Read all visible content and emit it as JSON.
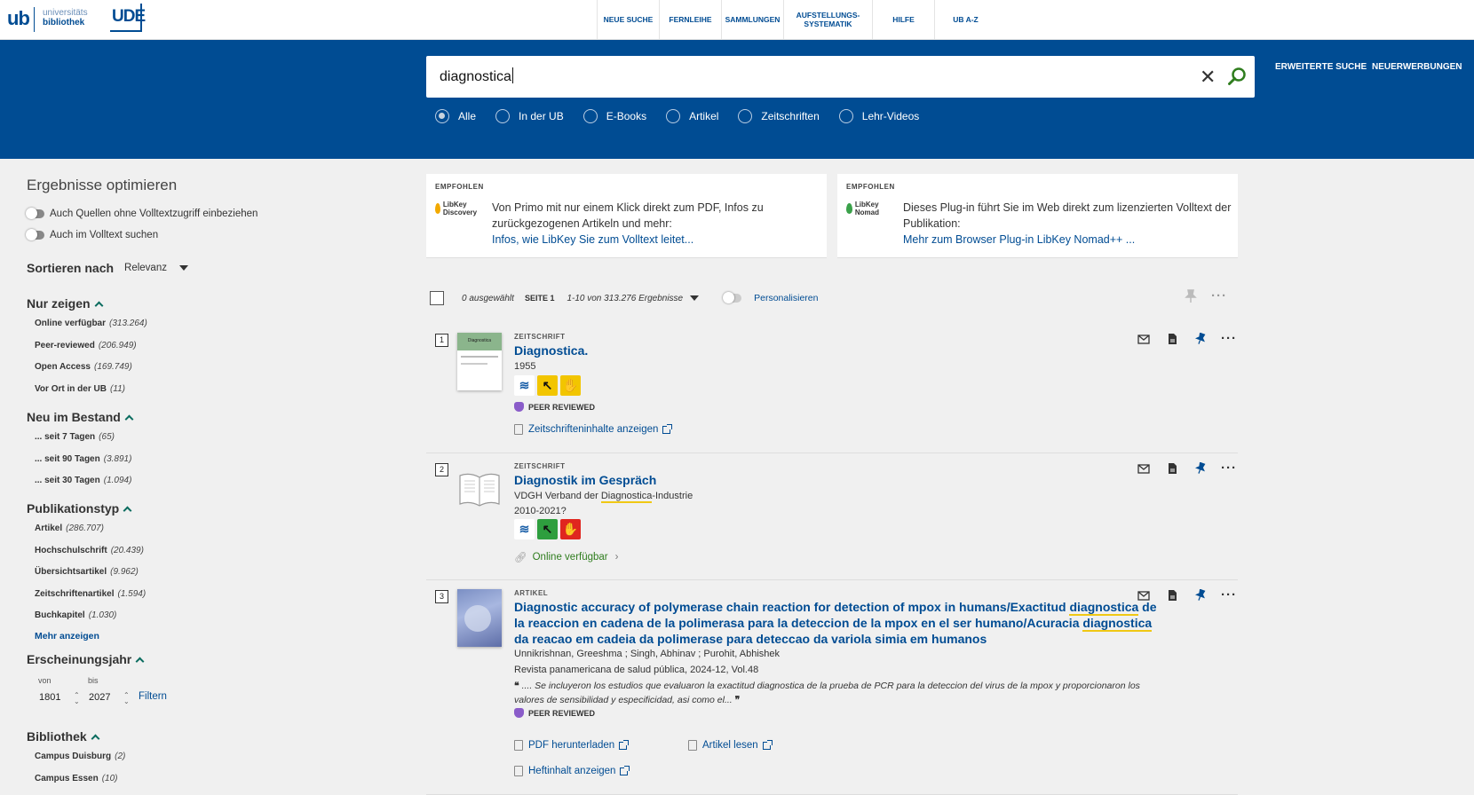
{
  "header": {
    "logo_ub": "ub",
    "logo_line1": "universitäts",
    "logo_line2": "bibliothek",
    "logo_ude": "UDE",
    "nav": [
      {
        "label": "NEUE SUCHE",
        "w": 70
      },
      {
        "label": "FERNLEIHE",
        "w": 70
      },
      {
        "label": "SAMMLUNGEN",
        "w": 70
      },
      {
        "label": "AUFSTELLUNGS-\nSYSTEMATIK",
        "w": 100
      },
      {
        "label": "HILFE",
        "w": 70
      },
      {
        "label": "UB A-Z",
        "w": 70
      }
    ]
  },
  "search": {
    "query": "diagnostica",
    "advanced_label": "ERWEITERTE SUCHE",
    "new_label": "NEUERWERBUNGEN",
    "scopes": [
      "Alle",
      "In der UB",
      "E-Books",
      "Artikel",
      "Zeitschriften",
      "Lehr-Videos"
    ]
  },
  "sidebar": {
    "title": "Ergebnisse optimieren",
    "toggle1": "Auch Quellen ohne Volltextzugriff einbeziehen",
    "toggle2": "Auch im Volltext suchen",
    "sort_label": "Sortieren nach",
    "sort_value": "Relevanz",
    "facets": [
      {
        "title": "Nur zeigen",
        "items": [
          [
            "Online verfügbar",
            "(313.264)"
          ],
          [
            "Peer-reviewed",
            "(206.949)"
          ],
          [
            "Open Access",
            "(169.749)"
          ],
          [
            "Vor Ort in der UB",
            "(11)"
          ]
        ]
      },
      {
        "title": "Neu im Bestand",
        "items": [
          [
            "... seit 7 Tagen",
            "(65)"
          ],
          [
            "... seit 90 Tagen",
            "(3.891)"
          ],
          [
            "... seit 30 Tagen",
            "(1.094)"
          ]
        ]
      },
      {
        "title": "Publikationstyp",
        "items": [
          [
            "Artikel",
            "(286.707)"
          ],
          [
            "Hochschulschrift",
            "(20.439)"
          ],
          [
            "Übersichtsartikel",
            "(9.962)"
          ],
          [
            "Zeitschriftenartikel",
            "(1.594)"
          ],
          [
            "Buchkapitel",
            "(1.030)"
          ]
        ],
        "more": "Mehr anzeigen"
      },
      {
        "title": "Erscheinungsjahr",
        "items": []
      },
      {
        "title": "Bibliothek",
        "items": [
          [
            "Campus Duisburg",
            "(2)"
          ],
          [
            "Campus Essen",
            "(10)"
          ]
        ]
      }
    ],
    "year": {
      "from_label": "von",
      "to_label": "bis",
      "from": "1801",
      "to": "2027",
      "filter": "Filtern"
    }
  },
  "cards": [
    {
      "tag": "EMPFOHLEN",
      "logo": "LibKey Discovery",
      "color": "#f2a900",
      "text": "Von Primo mit nur einem Klick direkt zum PDF, Infos zu zurückgezogenen Artikeln und mehr:",
      "link": "Infos, wie LibKey Sie zum Volltext leitet..."
    },
    {
      "tag": "EMPFOHLEN",
      "logo": "LibKey Nomad",
      "color": "#3aa14a",
      "text": "Dieses Plug-in führt Sie im Web direkt zum lizenzierten Volltext der Publikation:",
      "link": "Mehr zum Browser Plug-in LibKey Nomad++ ..."
    }
  ],
  "results_header": {
    "selected": "0 ausgewählt",
    "page": "SEITE 1",
    "range": "1-10 von 313.276 Ergebnisse",
    "personalize": "Personalisieren"
  },
  "results": [
    {
      "num": "1",
      "type": "ZEITSCHRIFT",
      "title": "Diagnostica.",
      "year": "1955",
      "peer": "PEER REVIEWED",
      "action": "Zeitschrifteninhalte anzeigen"
    },
    {
      "num": "2",
      "type": "ZEITSCHRIFT",
      "title": "Diagnostik im Gespräch",
      "publisher_pre": "VDGH Verband der ",
      "publisher_hl": "Diagnostica",
      "publisher_post": "-Industrie",
      "year": "2010-2021?",
      "online": "Online verfügbar"
    },
    {
      "num": "3",
      "type": "ARTIKEL",
      "title_l1a": "Diagnostic accuracy of polymerase chain reaction for detection of mpox in humans/Exactitud ",
      "title_l1b": "diagnostica",
      "title_l1c": " de",
      "title_l2a": "la reaccion en cadena de la polimerasa para la deteccion de la mpox en el ser humano/Acuracia ",
      "title_l2b": "diagnostica",
      "title_l3": "da reacao em cadeia da polimerase para deteccao da variola simia em humanos",
      "authors": "Unnikrishnan, Greeshma ; Singh, Abhinav ; Purohit, Abhishek",
      "source": "Revista panamericana de salud pública, 2024-12, Vol.48",
      "abstract_l1": ".... Se incluyeron los estudios que evaluaron la exactitud diagnostica de la prueba de PCR para la deteccion del virus de la mpox y proporcionaron los",
      "abstract_l2": "valores de sensibilidad y especificidad, asi como el...",
      "peer": "PEER REVIEWED",
      "pdf": "PDF herunterladen",
      "read": "Artikel lesen",
      "issue": "Heftinhalt anzeigen"
    }
  ]
}
